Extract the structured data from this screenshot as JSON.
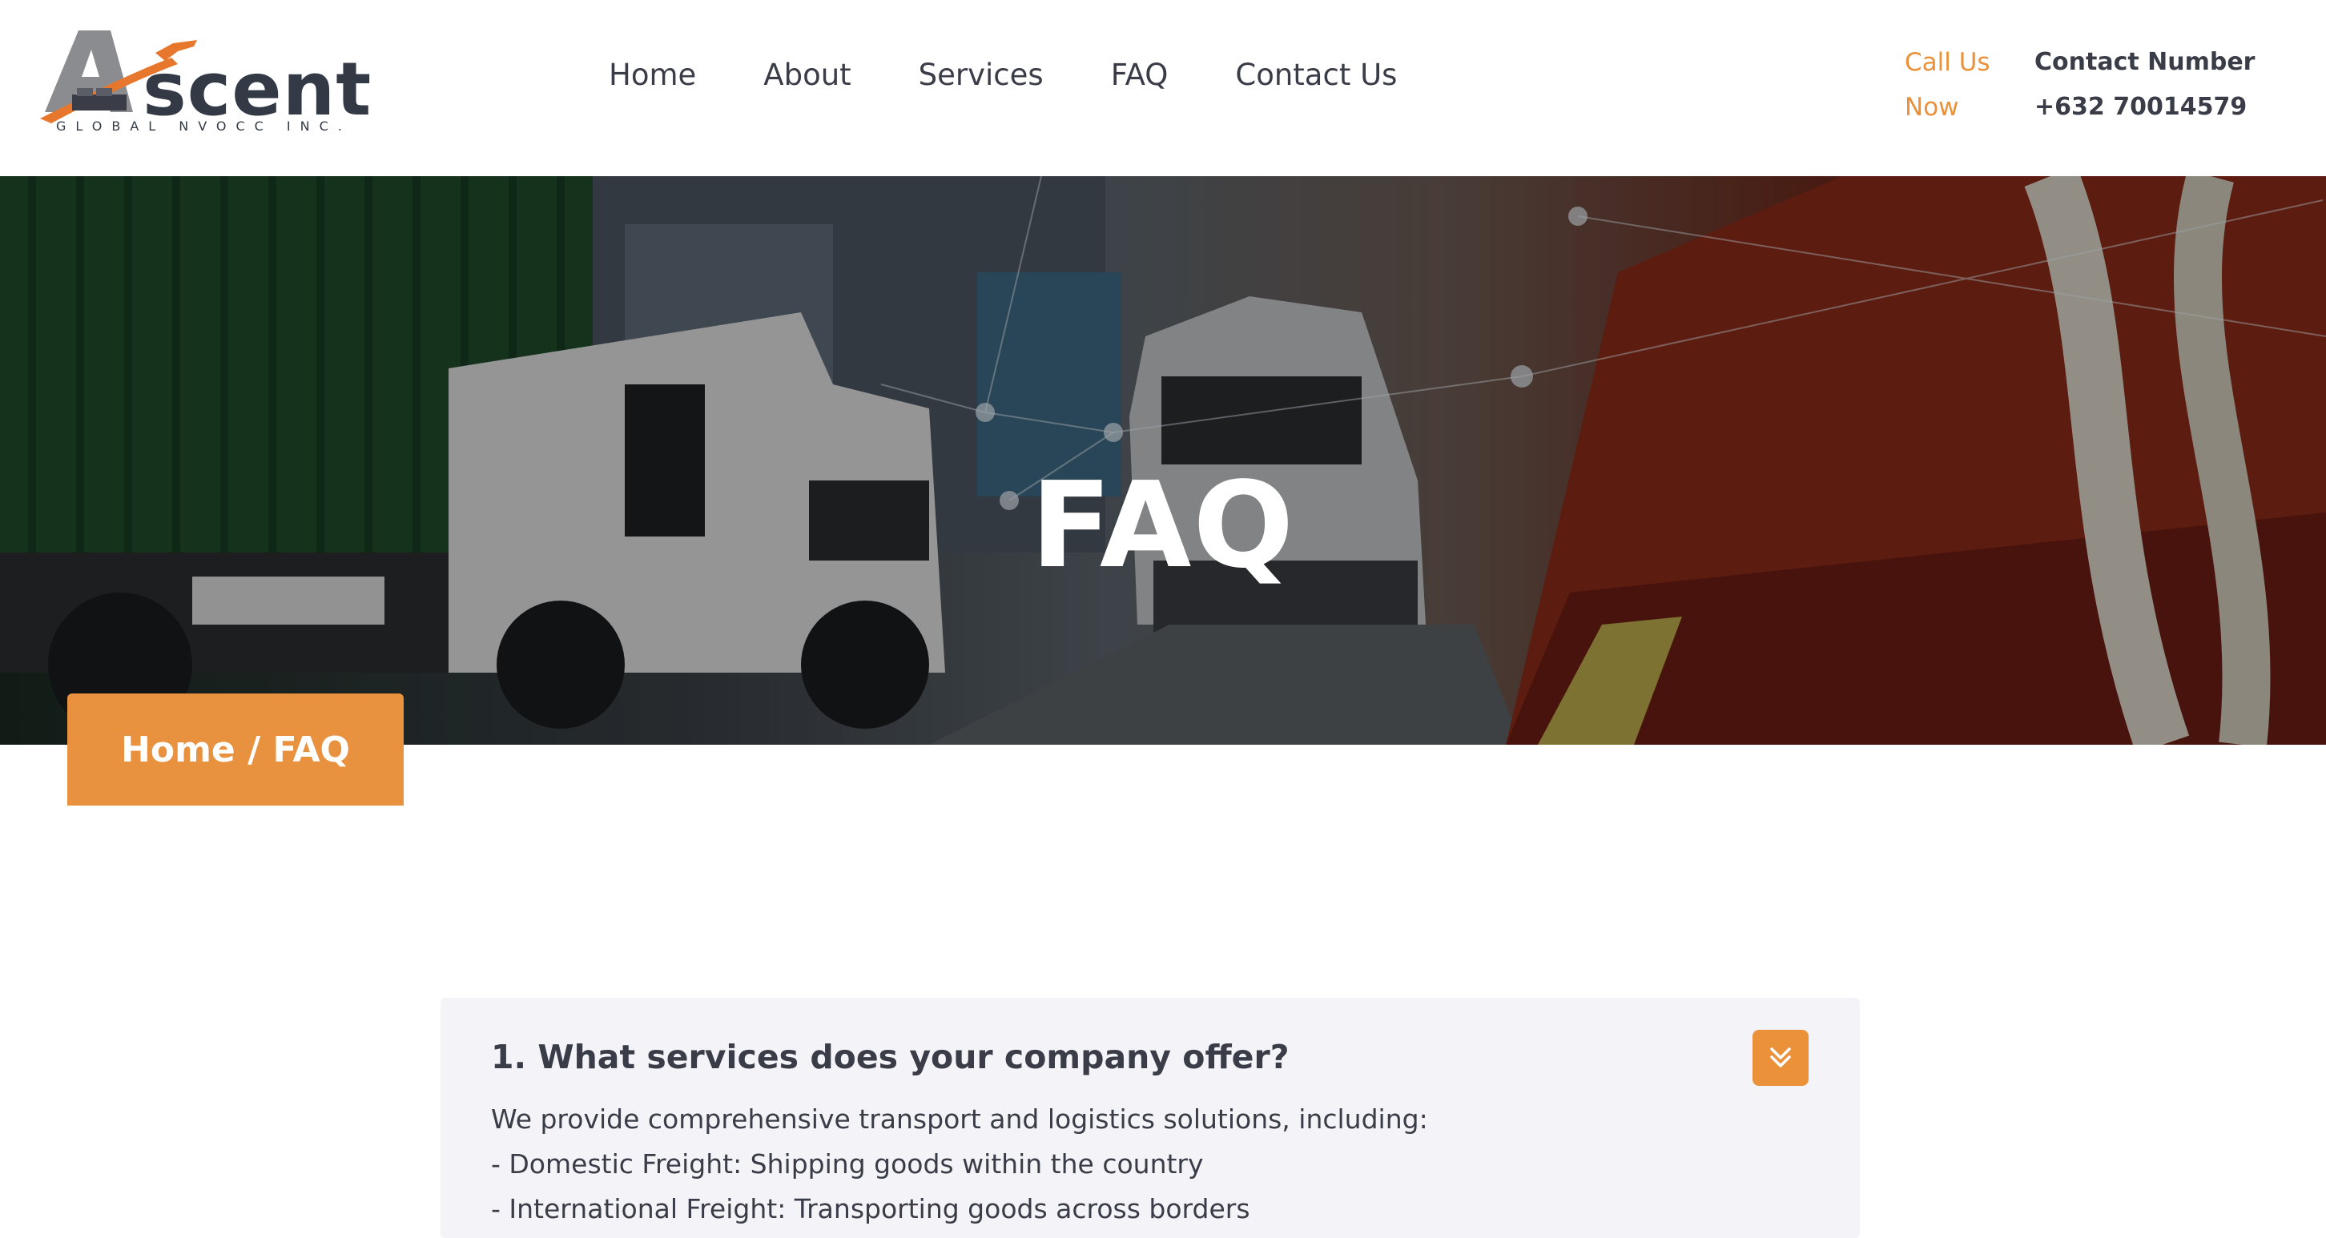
{
  "brand": {
    "logo_initial": "A",
    "logo_word": "scent",
    "logo_sub": "GLOBAL NVOCC INC."
  },
  "nav": {
    "items": [
      "Home",
      "About",
      "Services",
      "FAQ",
      "Contact Us"
    ]
  },
  "header": {
    "call_label": "Call Us Now",
    "contact_label": "Contact Number",
    "contact_number": "+632 70014579"
  },
  "hero": {
    "title": "FAQ",
    "breadcrumb": "Home / FAQ"
  },
  "faq": {
    "question": "1. What services does your company offer?",
    "answer_intro": "We provide comprehensive transport and logistics solutions, including:",
    "answer_items": [
      "- Domestic Freight: Shipping goods within the country",
      "- International Freight: Transporting goods across borders"
    ]
  },
  "colors": {
    "accent": "#ea913a",
    "text": "#3a3d48",
    "faq_bg": "#f3f3f8"
  }
}
